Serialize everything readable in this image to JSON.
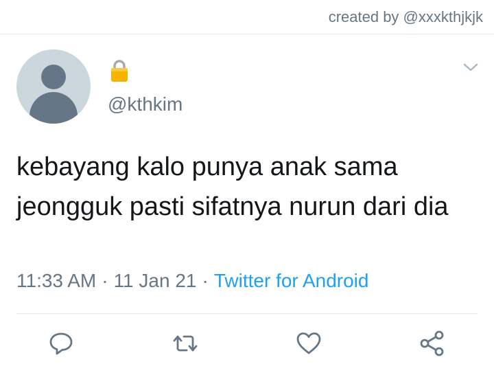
{
  "credit": "created by @xxxkthjkjk",
  "user": {
    "handle": "@kthkim",
    "locked": true
  },
  "tweet": {
    "text": "kebayang kalo punya anak sama jeongguk pasti sifatnya nurun dari dia",
    "time": "11:33 AM",
    "separator": "·",
    "date": "11 Jan 21",
    "source": "Twitter for Android"
  },
  "actions": [
    {
      "icon": "reply-icon"
    },
    {
      "icon": "retweet-icon"
    },
    {
      "icon": "like-icon"
    },
    {
      "icon": "share-icon"
    }
  ],
  "colors": {
    "accent": "#1da1f2",
    "secondary_text": "#657786",
    "divider": "#e1e8ed",
    "lock": "#f4b400"
  }
}
